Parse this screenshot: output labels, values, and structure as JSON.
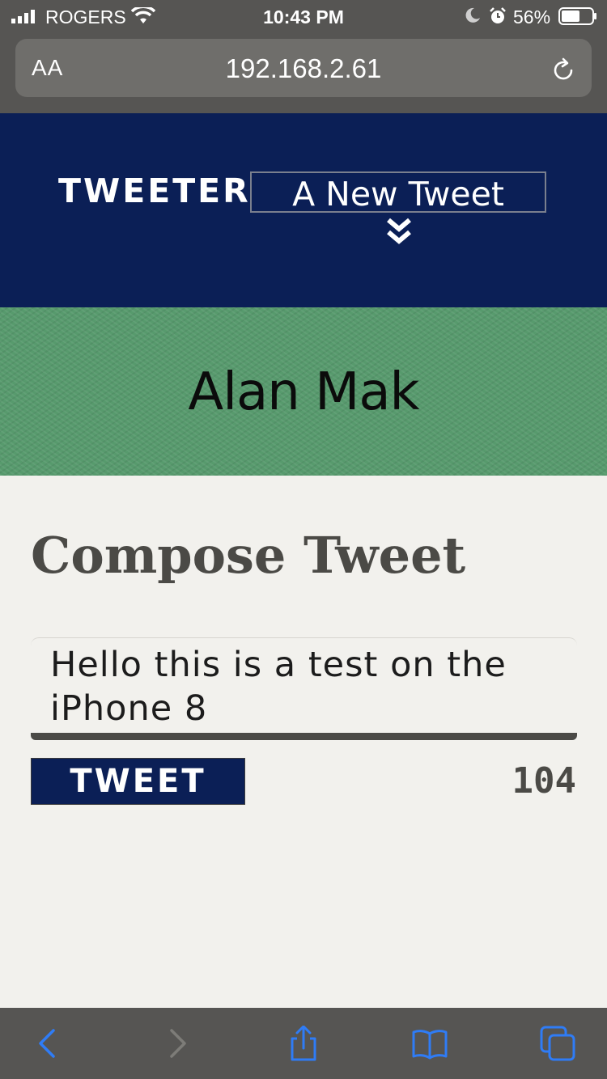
{
  "status_bar": {
    "carrier": "ROGERS",
    "time": "10:43 PM",
    "battery_percent": "56%"
  },
  "browser": {
    "text_size_label": "AA",
    "url": "192.168.2.61"
  },
  "header": {
    "brand": "TWEETER",
    "new_tweet_label": "A New Tweet"
  },
  "profile": {
    "name": "Alan Mak"
  },
  "compose": {
    "title": "Compose Tweet",
    "tweet_text": "Hello this is a test on the iPhone 8",
    "button_label": "TWEET",
    "char_counter": "104"
  },
  "colors": {
    "nav_bg": "#0b1f56",
    "profile_bg": "#579a6d",
    "page_bg": "#f2f1ed",
    "accent_blue": "#2f7cf6"
  },
  "toolbar": {
    "icons": [
      "back-icon",
      "forward-icon",
      "share-icon",
      "bookmarks-icon",
      "tabs-icon"
    ]
  }
}
